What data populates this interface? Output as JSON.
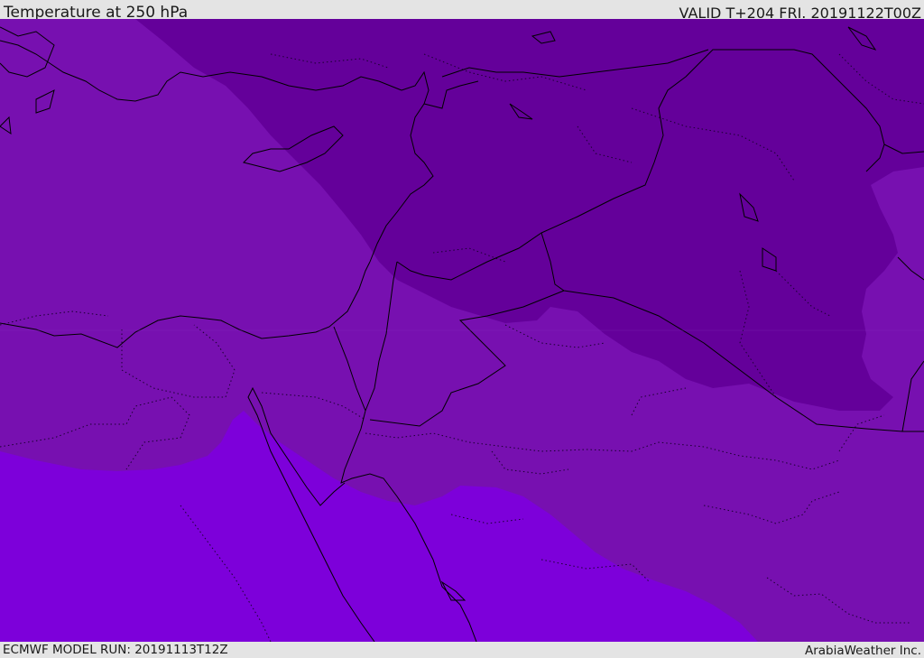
{
  "header": {
    "title": "Temperature at 250 hPa",
    "valid": "VALID T+204 FRI. 20191122T00Z"
  },
  "footer": {
    "model_run": "ECMWF MODEL RUN: 20191113T12Z",
    "credit": "ArabiaWeather Inc."
  },
  "colors": {
    "band_coldest": "#64009a",
    "band_mid": "#7710b0",
    "band_warm": "#7d00da",
    "coastline": "#000000",
    "bar_bg": "#e4e4e4"
  }
}
